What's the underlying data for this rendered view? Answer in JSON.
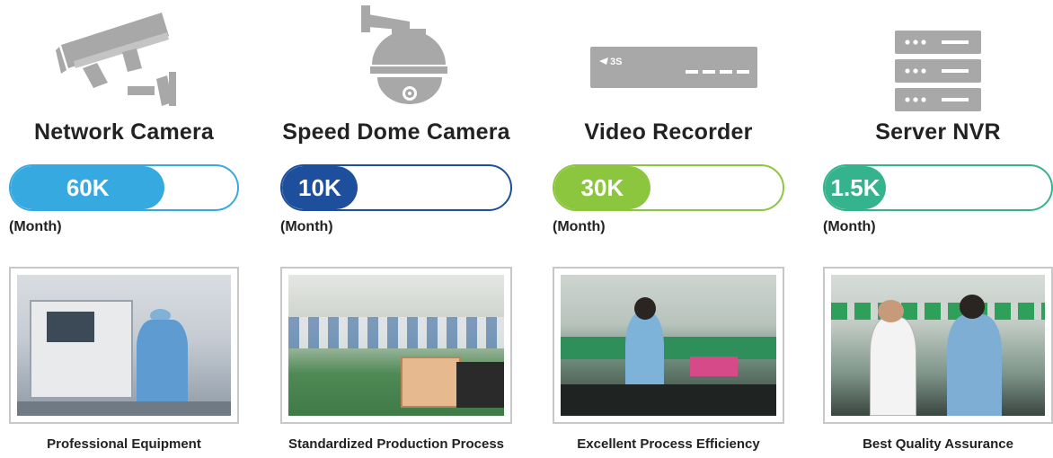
{
  "colors": {
    "blue": "#36a9e1",
    "navy": "#1d4f9c",
    "green": "#8cc63f",
    "teal": "#35b38c",
    "icon_gray": "#a8a8a8"
  },
  "products": [
    {
      "icon": "network-camera-icon",
      "title": "Network Camera",
      "value": "60K",
      "fill_percent": 68,
      "unit": "(Month)",
      "photo": "factory-equipment-photo",
      "caption": "Professional Equipment"
    },
    {
      "icon": "speed-dome-camera-icon",
      "title": "Speed Dome Camera",
      "value": "10K",
      "fill_percent": 33,
      "unit": "(Month)",
      "photo": "production-line-photo",
      "caption": "Standardized Production Process"
    },
    {
      "icon": "video-recorder-icon",
      "title": "Video Recorder",
      "value": "30K",
      "fill_percent": 42,
      "unit": "(Month)",
      "photo": "assembly-workers-photo",
      "caption": "Excellent Process Efficiency"
    },
    {
      "icon": "server-rack-icon",
      "title": "Server NVR",
      "value": "1.5K",
      "fill_percent": 27,
      "unit": "(Month)",
      "photo": "quality-inspection-photo",
      "caption": "Best Quality Assurance"
    }
  ],
  "recorder_logo": "3S"
}
